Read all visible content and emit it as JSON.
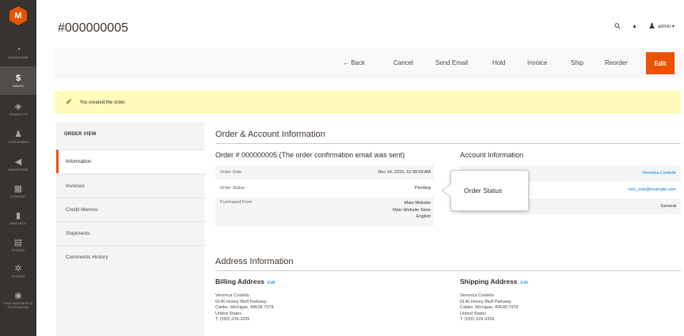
{
  "sidebar": {
    "logo": "M",
    "items": [
      {
        "label": "DASHBOARD",
        "icon": "dashboard-icon",
        "glyph": "◔"
      },
      {
        "label": "SALES",
        "icon": "dollar-icon",
        "glyph": "$"
      },
      {
        "label": "PRODUCTS",
        "icon": "cube-icon",
        "glyph": "◈"
      },
      {
        "label": "CUSTOMERS",
        "icon": "customer-icon",
        "glyph": "♟"
      },
      {
        "label": "MARKETING",
        "icon": "megaphone-icon",
        "glyph": "◀"
      },
      {
        "label": "CONTENT",
        "icon": "content-icon",
        "glyph": "▦"
      },
      {
        "label": "REPORTS",
        "icon": "bar-chart-icon",
        "glyph": "▮"
      },
      {
        "label": "STORES",
        "icon": "store-icon",
        "glyph": "▤"
      },
      {
        "label": "SYSTEM",
        "icon": "gear-icon",
        "glyph": "✲"
      },
      {
        "label": "FIND PARTNERS & EXTENSIONS",
        "icon": "extensions-icon",
        "glyph": "◉"
      }
    ]
  },
  "header": {
    "title": "#000000005",
    "search_glyph": "⚲",
    "bell_glyph": "▲",
    "user_glyph": "♟",
    "admin_label": "admin ▾"
  },
  "actions": {
    "back": "← Back",
    "cancel": "Cancel",
    "send_email": "Send Email",
    "hold": "Hold",
    "invoice": "Invoice",
    "ship": "Ship",
    "reorder": "Reorder",
    "edit": "Edit"
  },
  "message": {
    "check_glyph": "✔",
    "text": "You created the order."
  },
  "order_view": {
    "title": "ORDER VIEW",
    "tabs": [
      "Information",
      "Invoices",
      "Credit Memos",
      "Shipments",
      "Comments History"
    ]
  },
  "order_account": {
    "section_title": "Order & Account Information",
    "order_title": "Order # 000000005 (The order confirmation email was sent)",
    "rows": [
      {
        "key": "Order Date",
        "value": "Dec 14, 2015, 10:39:09 AM"
      },
      {
        "key": "Order Status",
        "value": "Pending"
      },
      {
        "key": "Purchased From",
        "value_lines": [
          "Main Website",
          "Main Website Store",
          "English"
        ]
      }
    ],
    "account_title": "Account Information",
    "account_values": [
      "Veronica Costello",
      "roni_cost@example.com",
      "General"
    ]
  },
  "callout": {
    "text": "Order Status"
  },
  "address": {
    "section_title": "Address Information",
    "billing": {
      "title": "Billing Address",
      "edit": "Edit",
      "lines": [
        "Veronica Costello",
        "6146 Honey Bluff Parkway",
        "Calder, Michigan, 49628-7978",
        "United States",
        "T: (555) 229-3326"
      ]
    },
    "shipping": {
      "title": "Shipping Address",
      "edit": "Edit",
      "lines": [
        "Veronica Costello",
        "6146 Honey Bluff Parkway",
        "Calder, Michigan, 49628-7978",
        "United States",
        "T: (555) 229-3326"
      ]
    }
  }
}
